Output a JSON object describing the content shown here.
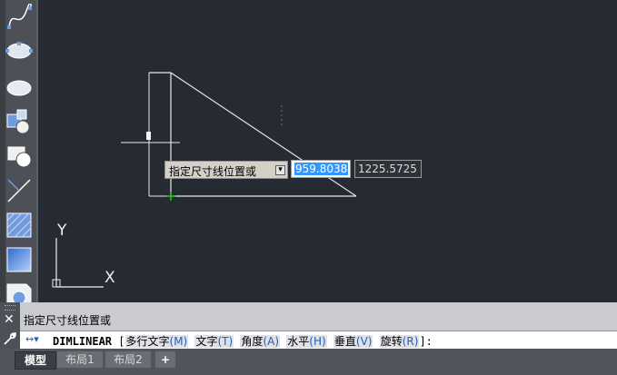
{
  "toolbar": {
    "tools": [
      "spline-tool",
      "ellipse-tool",
      "ellipse-arc-tool",
      "insert-block-tool",
      "create-block-tool",
      "point-tool",
      "hatch-tool",
      "gradient-tool",
      "region-tool"
    ]
  },
  "canvas": {
    "ucs_x_label": "X",
    "ucs_y_label": "Y"
  },
  "dynamic_input": {
    "prompt": "指定尺寸线位置或",
    "options_arrow": "▾",
    "value_primary": "959.8038",
    "value_secondary": "1225.5725"
  },
  "command": {
    "close_glyph": "✕",
    "history": "指定尺寸线位置或",
    "icon": "↔▾",
    "name": "DIMLINEAR",
    "bracket_open": "[",
    "options": [
      {
        "label": "多行文字",
        "key": "(M)"
      },
      {
        "label": "文字",
        "key": "(T)"
      },
      {
        "label": "角度",
        "key": "(A)"
      },
      {
        "label": "水平",
        "key": "(H)"
      },
      {
        "label": "垂直",
        "key": "(V)"
      },
      {
        "label": "旋转",
        "key": "(R)"
      }
    ],
    "bracket_close": "]:"
  },
  "tabs": {
    "model": "模型",
    "layout1": "布局1",
    "layout2": "布局2",
    "add": "+"
  },
  "colors": {
    "canvas_bg": "#252a33",
    "selection": "#3399ff",
    "key_blue": "#1f5fbf"
  }
}
